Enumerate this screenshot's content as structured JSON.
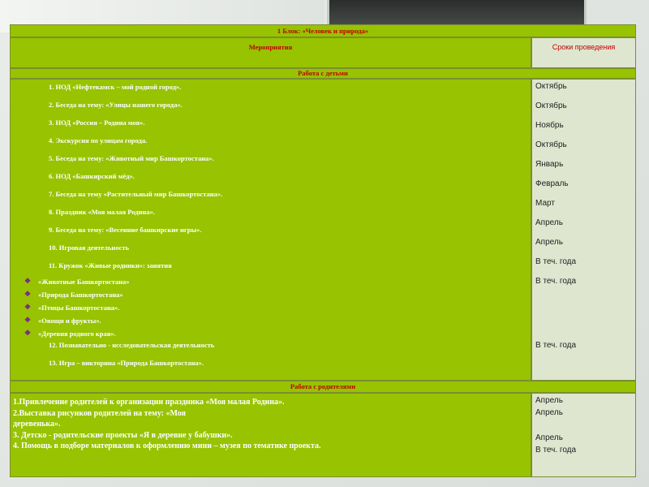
{
  "title": "1 Блок: «Человек и природа»",
  "header": {
    "col_events": "Мероприятия",
    "col_dates": "Сроки проведения"
  },
  "section_children": "Работа с детьми",
  "children_items": [
    "1. НОД «Нефтекамск – мой родной город».",
    "2. Беседа на тему: «Улицы нашего города».",
    "3. НОД «Россия – Родина моя».",
    "4. Экскурсия по улицам города.",
    "5. Беседа на тему: «Животный мир Башкортостана».",
    "6. НОД «Башкирский мёд».",
    "7. Беседа на тему «Растительный мир Башкортостана».",
    "8. Праздник «Моя малая Родина».",
    "9. Беседа на тему: «Весенние башкирские игры».",
    "10. Игровая деятельность",
    "11. Кружок «Живые родники»: занятия"
  ],
  "club_topics": [
    "«Животные Башкортостана»",
    "«Природа Башкортостана»",
    "«Птицы Башкортостана».",
    "«Овощи и фрукты».",
    "«Деревня родного края»."
  ],
  "children_items_after": [
    "12. Познавательно - исследовательская деятельность",
    "13.  Игра – викторина «Природа Башкортостана»."
  ],
  "children_dates": [
    "Октябрь",
    "Октябрь",
    "Ноябрь",
    "Октябрь",
    "Январь",
    "Февраль",
    "Март",
    "Апрель",
    "Апрель",
    "В теч. года",
    "В теч. года",
    "В теч. года"
  ],
  "section_parents": "Работа с родителями",
  "parents_lines": [
    "1.Привлечение родителей к организации праздника «Моя малая Родина».",
    "2.Выставка рисунков родителей на тему: «Моя",
    "деревенька».",
    "3. Детско - родительские проекты «Я в деревне у бабушки».",
    "4. Помощь в подборе материалов к оформлению мини – музея по тематике проекта."
  ],
  "parents_dates": [
    "Апрель",
    " Апрель",
    "Апрель",
    " В теч. года"
  ],
  "colors": {
    "green": "#97c300",
    "light": "#dfe6cf",
    "red": "#c00000",
    "bullet": "#7a2a8f"
  },
  "icons": {
    "bullet": "diamond-bullet-icon"
  }
}
